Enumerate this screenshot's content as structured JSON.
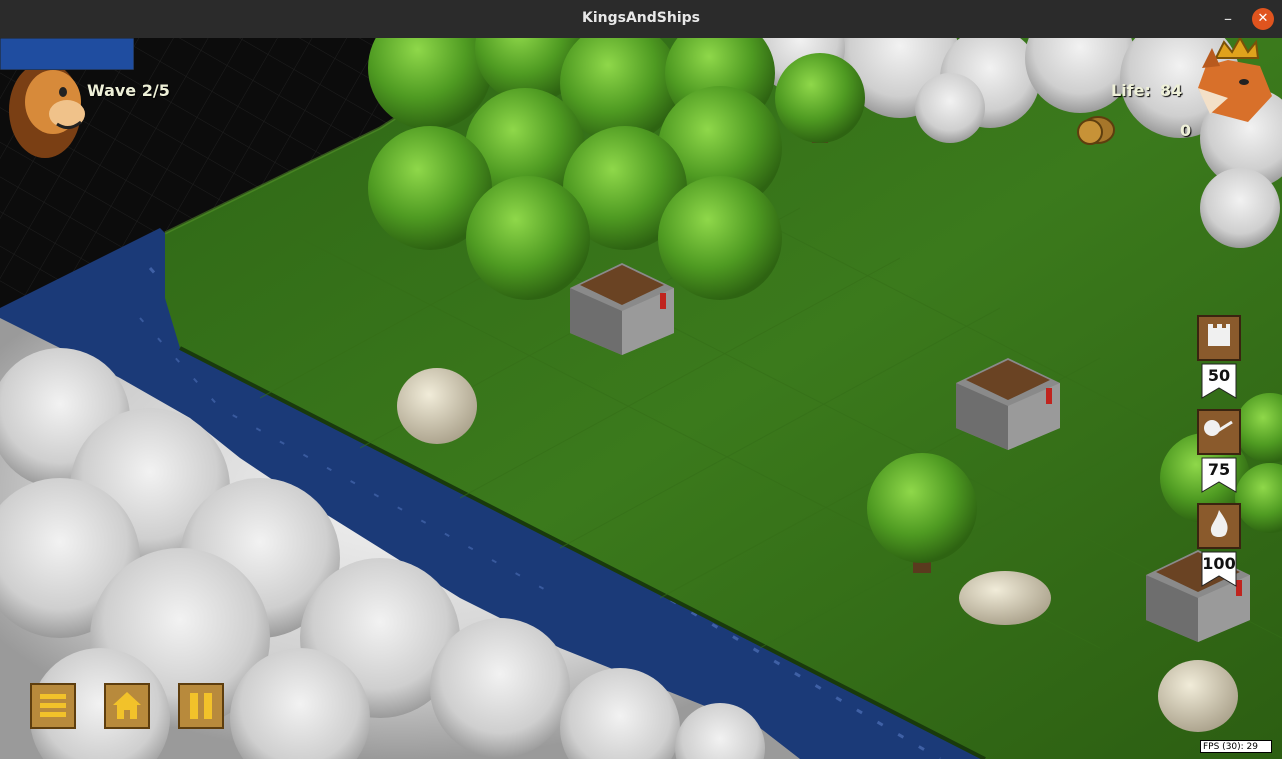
{
  "window": {
    "title": "KingsAndShips",
    "minimize_glyph": "–",
    "close_glyph": "✕"
  },
  "hud": {
    "wave_label": "Wave 2/5",
    "life_label": "Life:",
    "life_value": "84",
    "gold_value": "0",
    "wave_progress": 0.6,
    "life_progress": 0.84,
    "player_avatar": "lion-king-icon",
    "enemy_avatar": "fox-king-icon",
    "gold_icon": "gold-coins-icon"
  },
  "shop": [
    {
      "icon": "tower-icon",
      "price": "50"
    },
    {
      "icon": "catapult-icon",
      "price": "75"
    },
    {
      "icon": "fire-icon",
      "price": "100"
    }
  ],
  "menu": [
    {
      "icon": "menu-icon"
    },
    {
      "icon": "home-icon"
    },
    {
      "icon": "pause-icon"
    }
  ],
  "fps": "FPS (30): 29",
  "colors": {
    "grass": "#3f7a1c",
    "river": "#1b3a78",
    "wave_bar": "#3f8a1f",
    "life_bar": "#3f8a1f",
    "gold_bar": "#1f4da0",
    "close_button": "#e0541e"
  }
}
